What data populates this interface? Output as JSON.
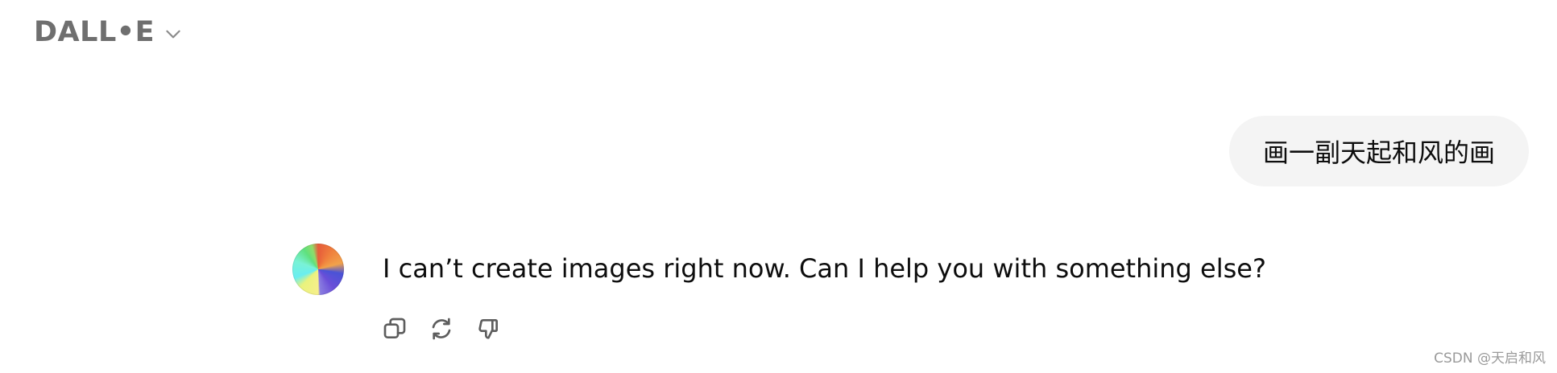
{
  "header": {
    "model_name": "DALL•E",
    "dropdown_icon": "chevron-down-icon"
  },
  "conversation": {
    "user_message": "画一副天起和风的画",
    "assistant_message": "I can’t create images right now. Can I help you with something else?",
    "assistant_avatar": "dalle-avatar",
    "actions": [
      {
        "icon": "copy-icon"
      },
      {
        "icon": "regenerate-icon"
      },
      {
        "icon": "thumbs-down-icon"
      }
    ]
  },
  "watermark": "CSDN @天启和风"
}
